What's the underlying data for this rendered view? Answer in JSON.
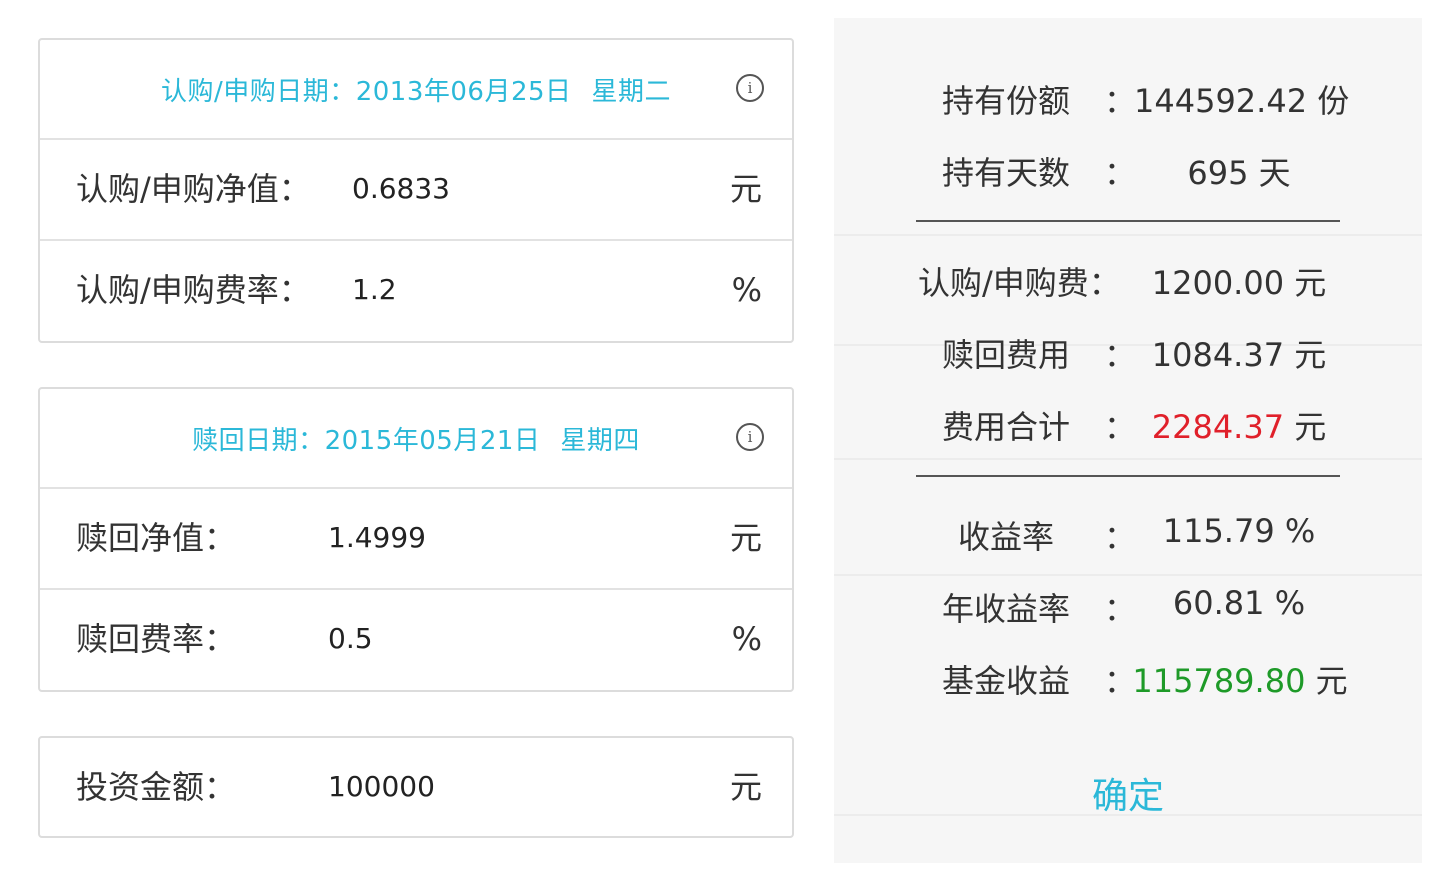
{
  "purchase_card": {
    "date_label": "认购/申购日期：",
    "date_value": "2013年06月25日",
    "weekday": "星期二",
    "nav_label": "认购/申购净值：",
    "nav_value": "0.6833",
    "nav_unit": "元",
    "fee_label": "认购/申购费率：",
    "fee_value": "1.2",
    "fee_unit": "%"
  },
  "redeem_card": {
    "date_label": "赎回日期：",
    "date_value": "2015年05月21日",
    "weekday": "星期四",
    "nav_label": "赎回净值：",
    "nav_value": "1.4999",
    "nav_unit": "元",
    "fee_label": "赎回费率：",
    "fee_value": "0.5",
    "fee_unit": "%"
  },
  "invest_card": {
    "label": "投资金额：",
    "value": "100000",
    "unit": "元"
  },
  "result": {
    "colon": "：",
    "shares_label": "持有份额",
    "shares_value": "144592.42 份",
    "days_label": "持有天数",
    "days_value": "695 天",
    "buy_fee_label": "认购/申购费：",
    "buy_fee_value": "1200.00 元",
    "redeem_fee_label": "赎回费用",
    "redeem_fee_value": "1084.37 元",
    "total_fee_label": "费用合计",
    "total_fee_number": "2284.37",
    "total_fee_unit": "元",
    "yield_label": "收益率",
    "yield_value": "115.79 %",
    "annual_yield_label": "年收益率",
    "annual_yield_value": "60.81 %",
    "profit_label": "基金收益",
    "profit_number": "115789.80",
    "profit_unit": "元",
    "confirm_label": "确定"
  },
  "colors": {
    "accent": "#2bb8d8",
    "red": "#e0202a",
    "green": "#1e9a28"
  }
}
